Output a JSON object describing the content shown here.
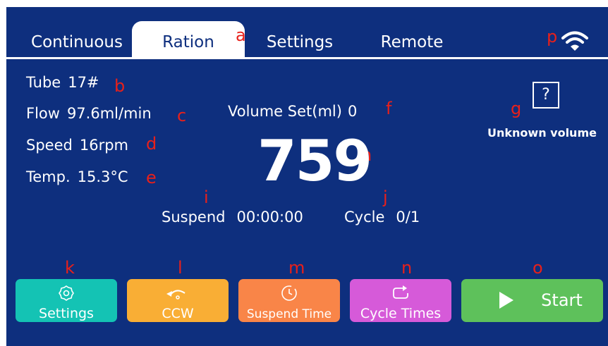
{
  "tabs": [
    {
      "label": "Continuous"
    },
    {
      "label": "Ration",
      "active": true
    },
    {
      "label": "Settings"
    },
    {
      "label": "Remote"
    }
  ],
  "markers": {
    "a": "a",
    "b": "b",
    "c": "c",
    "d": "d",
    "e": "e",
    "f": "f",
    "g": "g",
    "h": "h",
    "i": "i",
    "j": "j",
    "k": "k",
    "l": "l",
    "m": "m",
    "n": "n",
    "o": "o",
    "p": "p"
  },
  "info": {
    "tube": {
      "label": "Tube",
      "value": "17#"
    },
    "flow": {
      "label": "Flow",
      "value": "97.6ml/min"
    },
    "speed": {
      "label": "Speed",
      "value": "16rpm"
    },
    "temp": {
      "label": "Temp.",
      "value": "15.3°C"
    }
  },
  "volume": {
    "label": "Volume Set(ml)",
    "value": "0",
    "big_value": "759"
  },
  "unknown_volume": {
    "icon": "question-icon",
    "symbol": "?",
    "label": "Unknown volume"
  },
  "status": {
    "suspend": {
      "label": "Suspend",
      "value": "00:00:00"
    },
    "cycle": {
      "label": "Cycle",
      "value": "0/1"
    }
  },
  "buttons": {
    "settings": {
      "label": "Settings",
      "color": "#14c3b4",
      "icon": "gear-icon"
    },
    "ccw": {
      "label": "CCW",
      "color": "#f9ae35",
      "icon": "ccw-rotate-icon"
    },
    "suspend_time": {
      "label": "Suspend Time",
      "color": "#f98548",
      "icon": "timer-icon"
    },
    "cycle_times": {
      "label": "Cycle Times",
      "color": "#d65ad9",
      "icon": "cycle-icon"
    },
    "start": {
      "label": "Start",
      "color": "#5ec15b",
      "icon": "play-icon"
    }
  },
  "colors": {
    "background": "#0e2f7e",
    "marker": "#e8201a",
    "text": "#ffffff"
  }
}
